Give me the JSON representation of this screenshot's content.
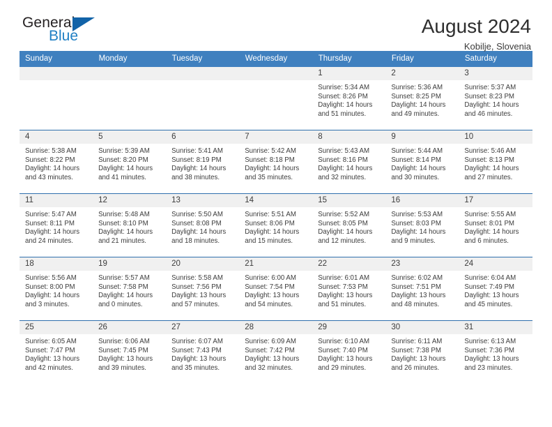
{
  "brand": {
    "name_top": "General",
    "name_bottom": "Blue",
    "accent_color": "#1f7fc4",
    "triangle_color": "#1263a8"
  },
  "header": {
    "title": "August 2024",
    "subtitle": "Kobilje, Slovenia"
  },
  "calendar": {
    "header_background": "#3f80bf",
    "header_text_color": "#ffffff",
    "daynum_background": "#f0f0f0",
    "row_divider_color": "#2f6fad",
    "weekdays": [
      "Sunday",
      "Monday",
      "Tuesday",
      "Wednesday",
      "Thursday",
      "Friday",
      "Saturday"
    ],
    "weeks": [
      [
        {
          "day": "",
          "empty": true
        },
        {
          "day": "",
          "empty": true
        },
        {
          "day": "",
          "empty": true
        },
        {
          "day": "",
          "empty": true
        },
        {
          "day": "1",
          "sunrise": "Sunrise: 5:34 AM",
          "sunset": "Sunset: 8:26 PM",
          "daylight_line1": "Daylight: 14 hours",
          "daylight_line2": "and 51 minutes."
        },
        {
          "day": "2",
          "sunrise": "Sunrise: 5:36 AM",
          "sunset": "Sunset: 8:25 PM",
          "daylight_line1": "Daylight: 14 hours",
          "daylight_line2": "and 49 minutes."
        },
        {
          "day": "3",
          "sunrise": "Sunrise: 5:37 AM",
          "sunset": "Sunset: 8:23 PM",
          "daylight_line1": "Daylight: 14 hours",
          "daylight_line2": "and 46 minutes."
        }
      ],
      [
        {
          "day": "4",
          "sunrise": "Sunrise: 5:38 AM",
          "sunset": "Sunset: 8:22 PM",
          "daylight_line1": "Daylight: 14 hours",
          "daylight_line2": "and 43 minutes."
        },
        {
          "day": "5",
          "sunrise": "Sunrise: 5:39 AM",
          "sunset": "Sunset: 8:20 PM",
          "daylight_line1": "Daylight: 14 hours",
          "daylight_line2": "and 41 minutes."
        },
        {
          "day": "6",
          "sunrise": "Sunrise: 5:41 AM",
          "sunset": "Sunset: 8:19 PM",
          "daylight_line1": "Daylight: 14 hours",
          "daylight_line2": "and 38 minutes."
        },
        {
          "day": "7",
          "sunrise": "Sunrise: 5:42 AM",
          "sunset": "Sunset: 8:18 PM",
          "daylight_line1": "Daylight: 14 hours",
          "daylight_line2": "and 35 minutes."
        },
        {
          "day": "8",
          "sunrise": "Sunrise: 5:43 AM",
          "sunset": "Sunset: 8:16 PM",
          "daylight_line1": "Daylight: 14 hours",
          "daylight_line2": "and 32 minutes."
        },
        {
          "day": "9",
          "sunrise": "Sunrise: 5:44 AM",
          "sunset": "Sunset: 8:14 PM",
          "daylight_line1": "Daylight: 14 hours",
          "daylight_line2": "and 30 minutes."
        },
        {
          "day": "10",
          "sunrise": "Sunrise: 5:46 AM",
          "sunset": "Sunset: 8:13 PM",
          "daylight_line1": "Daylight: 14 hours",
          "daylight_line2": "and 27 minutes."
        }
      ],
      [
        {
          "day": "11",
          "sunrise": "Sunrise: 5:47 AM",
          "sunset": "Sunset: 8:11 PM",
          "daylight_line1": "Daylight: 14 hours",
          "daylight_line2": "and 24 minutes."
        },
        {
          "day": "12",
          "sunrise": "Sunrise: 5:48 AM",
          "sunset": "Sunset: 8:10 PM",
          "daylight_line1": "Daylight: 14 hours",
          "daylight_line2": "and 21 minutes."
        },
        {
          "day": "13",
          "sunrise": "Sunrise: 5:50 AM",
          "sunset": "Sunset: 8:08 PM",
          "daylight_line1": "Daylight: 14 hours",
          "daylight_line2": "and 18 minutes."
        },
        {
          "day": "14",
          "sunrise": "Sunrise: 5:51 AM",
          "sunset": "Sunset: 8:06 PM",
          "daylight_line1": "Daylight: 14 hours",
          "daylight_line2": "and 15 minutes."
        },
        {
          "day": "15",
          "sunrise": "Sunrise: 5:52 AM",
          "sunset": "Sunset: 8:05 PM",
          "daylight_line1": "Daylight: 14 hours",
          "daylight_line2": "and 12 minutes."
        },
        {
          "day": "16",
          "sunrise": "Sunrise: 5:53 AM",
          "sunset": "Sunset: 8:03 PM",
          "daylight_line1": "Daylight: 14 hours",
          "daylight_line2": "and 9 minutes."
        },
        {
          "day": "17",
          "sunrise": "Sunrise: 5:55 AM",
          "sunset": "Sunset: 8:01 PM",
          "daylight_line1": "Daylight: 14 hours",
          "daylight_line2": "and 6 minutes."
        }
      ],
      [
        {
          "day": "18",
          "sunrise": "Sunrise: 5:56 AM",
          "sunset": "Sunset: 8:00 PM",
          "daylight_line1": "Daylight: 14 hours",
          "daylight_line2": "and 3 minutes."
        },
        {
          "day": "19",
          "sunrise": "Sunrise: 5:57 AM",
          "sunset": "Sunset: 7:58 PM",
          "daylight_line1": "Daylight: 14 hours",
          "daylight_line2": "and 0 minutes."
        },
        {
          "day": "20",
          "sunrise": "Sunrise: 5:58 AM",
          "sunset": "Sunset: 7:56 PM",
          "daylight_line1": "Daylight: 13 hours",
          "daylight_line2": "and 57 minutes."
        },
        {
          "day": "21",
          "sunrise": "Sunrise: 6:00 AM",
          "sunset": "Sunset: 7:54 PM",
          "daylight_line1": "Daylight: 13 hours",
          "daylight_line2": "and 54 minutes."
        },
        {
          "day": "22",
          "sunrise": "Sunrise: 6:01 AM",
          "sunset": "Sunset: 7:53 PM",
          "daylight_line1": "Daylight: 13 hours",
          "daylight_line2": "and 51 minutes."
        },
        {
          "day": "23",
          "sunrise": "Sunrise: 6:02 AM",
          "sunset": "Sunset: 7:51 PM",
          "daylight_line1": "Daylight: 13 hours",
          "daylight_line2": "and 48 minutes."
        },
        {
          "day": "24",
          "sunrise": "Sunrise: 6:04 AM",
          "sunset": "Sunset: 7:49 PM",
          "daylight_line1": "Daylight: 13 hours",
          "daylight_line2": "and 45 minutes."
        }
      ],
      [
        {
          "day": "25",
          "sunrise": "Sunrise: 6:05 AM",
          "sunset": "Sunset: 7:47 PM",
          "daylight_line1": "Daylight: 13 hours",
          "daylight_line2": "and 42 minutes."
        },
        {
          "day": "26",
          "sunrise": "Sunrise: 6:06 AM",
          "sunset": "Sunset: 7:45 PM",
          "daylight_line1": "Daylight: 13 hours",
          "daylight_line2": "and 39 minutes."
        },
        {
          "day": "27",
          "sunrise": "Sunrise: 6:07 AM",
          "sunset": "Sunset: 7:43 PM",
          "daylight_line1": "Daylight: 13 hours",
          "daylight_line2": "and 35 minutes."
        },
        {
          "day": "28",
          "sunrise": "Sunrise: 6:09 AM",
          "sunset": "Sunset: 7:42 PM",
          "daylight_line1": "Daylight: 13 hours",
          "daylight_line2": "and 32 minutes."
        },
        {
          "day": "29",
          "sunrise": "Sunrise: 6:10 AM",
          "sunset": "Sunset: 7:40 PM",
          "daylight_line1": "Daylight: 13 hours",
          "daylight_line2": "and 29 minutes."
        },
        {
          "day": "30",
          "sunrise": "Sunrise: 6:11 AM",
          "sunset": "Sunset: 7:38 PM",
          "daylight_line1": "Daylight: 13 hours",
          "daylight_line2": "and 26 minutes."
        },
        {
          "day": "31",
          "sunrise": "Sunrise: 6:13 AM",
          "sunset": "Sunset: 7:36 PM",
          "daylight_line1": "Daylight: 13 hours",
          "daylight_line2": "and 23 minutes."
        }
      ]
    ]
  }
}
